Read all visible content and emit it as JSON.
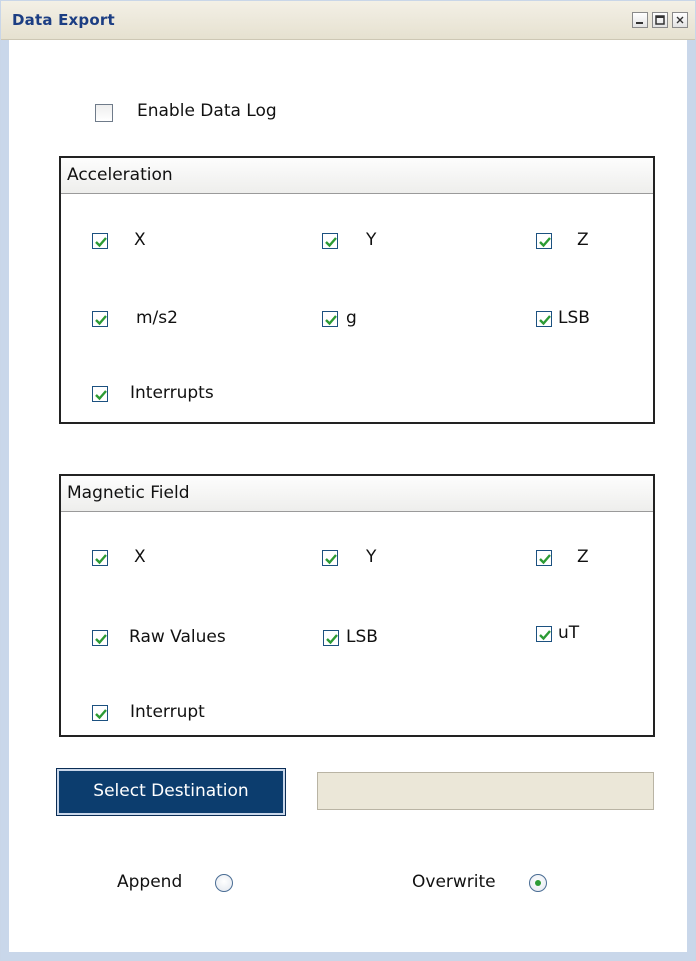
{
  "window": {
    "title": "Data Export"
  },
  "enable_log": {
    "label": "Enable Data Log",
    "checked": false
  },
  "acceleration": {
    "title": "Acceleration",
    "items": [
      {
        "label": "X",
        "checked": true
      },
      {
        "label": "Y",
        "checked": true
      },
      {
        "label": "Z",
        "checked": true
      },
      {
        "label": "m/s2",
        "checked": true
      },
      {
        "label": "g",
        "checked": true
      },
      {
        "label": "LSB",
        "checked": true
      },
      {
        "label": "Interrupts",
        "checked": true
      }
    ]
  },
  "magnetic": {
    "title": "Magnetic Field",
    "items": [
      {
        "label": "X",
        "checked": true
      },
      {
        "label": "Y",
        "checked": true
      },
      {
        "label": "Z",
        "checked": true
      },
      {
        "label": "Raw Values",
        "checked": true
      },
      {
        "label": "LSB",
        "checked": true
      },
      {
        "label": "uT",
        "checked": true
      },
      {
        "label": "Interrupt",
        "checked": true
      }
    ]
  },
  "destination": {
    "button_label": "Select Destination",
    "path_value": ""
  },
  "mode": {
    "append_label": "Append",
    "overwrite_label": "Overwrite",
    "selected": "Overwrite"
  },
  "colors": {
    "title_text": "#1c3e83",
    "button_bg": "#0c3d6e",
    "check_green": "#2c9b34"
  }
}
